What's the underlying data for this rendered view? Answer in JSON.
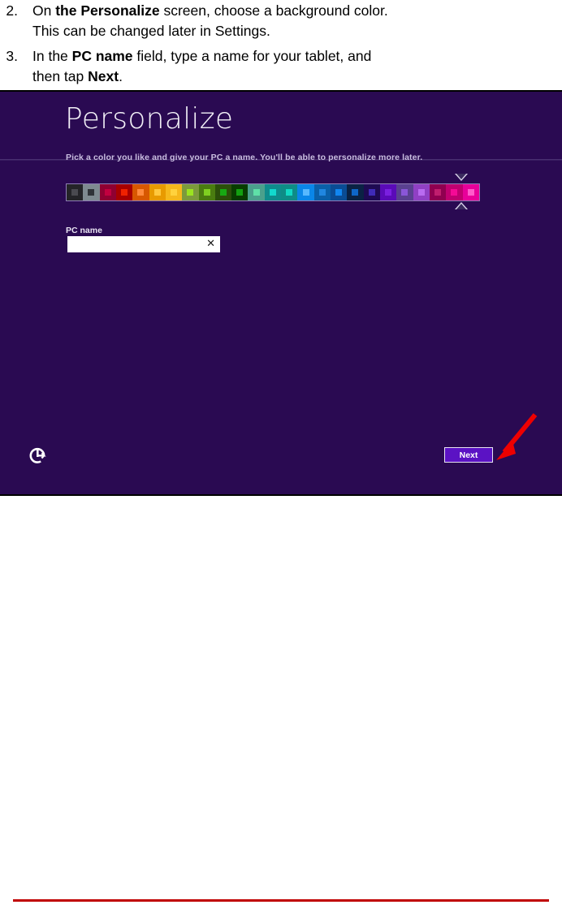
{
  "document": {
    "steps": [
      {
        "number": "2.",
        "line1_pre": "On ",
        "line1_bold": "the Personalize",
        "line1_post": " screen, choose a background color.",
        "line2": "This can be changed later in Settings."
      },
      {
        "number": "3.",
        "line1_pre": "In the ",
        "line1_bold": "PC name",
        "line1_post": " field, type a name for your tablet, and",
        "line2_pre": "then tap ",
        "line2_bold": "Next",
        "line2_post": "."
      }
    ]
  },
  "screenshot": {
    "title": "Personalize",
    "subtitle": "Pick a color you like and give your PC a name. You'll be able to personalize more later.",
    "background_color": "#2A0A52",
    "color_picker": {
      "name": "background-color-picker",
      "selected_index": 23,
      "swatches": [
        {
          "index": 0,
          "color": "#242428",
          "chip": "#4A4A50"
        },
        {
          "index": 1,
          "color": "#7E8A90",
          "chip": "#2F3338"
        },
        {
          "index": 2,
          "color": "#8F0032",
          "chip": "#C2003F"
        },
        {
          "index": 3,
          "color": "#A80000",
          "chip": "#F02200"
        },
        {
          "index": 4,
          "color": "#D85800",
          "chip": "#FF8A3D"
        },
        {
          "index": 5,
          "color": "#E89A00",
          "chip": "#FFC83D"
        },
        {
          "index": 6,
          "color": "#F5B81C",
          "chip": "#FFD23D"
        },
        {
          "index": 7,
          "color": "#7C9A3C",
          "chip": "#9BE320"
        },
        {
          "index": 8,
          "color": "#4A7C10",
          "chip": "#7FD021"
        },
        {
          "index": 9,
          "color": "#2B4F0A",
          "chip": "#17A913"
        },
        {
          "index": 10,
          "color": "#083D00",
          "chip": "#13A011"
        },
        {
          "index": 11,
          "color": "#4AA08C",
          "chip": "#5FE0A8"
        },
        {
          "index": 12,
          "color": "#0E8C8C",
          "chip": "#12D9CE"
        },
        {
          "index": 13,
          "color": "#0E8C86",
          "chip": "#12D9C4"
        },
        {
          "index": 14,
          "color": "#0A86E8",
          "chip": "#57B8FF"
        },
        {
          "index": 15,
          "color": "#0A5FA8",
          "chip": "#2086E0"
        },
        {
          "index": 16,
          "color": "#0A4C94",
          "chip": "#1186F0"
        },
        {
          "index": 17,
          "color": "#0A2244",
          "chip": "#0E66C8"
        },
        {
          "index": 18,
          "color": "#1E0A52",
          "chip": "#3F2BB8"
        },
        {
          "index": 19,
          "color": "#5A0AB8",
          "chip": "#7A1FE0"
        },
        {
          "index": 20,
          "color": "#5A4090",
          "chip": "#8A56D8"
        },
        {
          "index": 21,
          "color": "#9040C4",
          "chip": "#B96BF0"
        },
        {
          "index": 22,
          "color": "#8F0050",
          "chip": "#C01E6E"
        },
        {
          "index": 23,
          "color": "#C00070",
          "chip": "#F50A96"
        },
        {
          "index": 24,
          "color": "#E8009A",
          "chip": "#FF5CCB"
        }
      ]
    },
    "pc_name_field": {
      "label": "PC name",
      "value": "",
      "placeholder": "",
      "clear_glyph": "✕"
    },
    "ease_of_access": {
      "name": "ease-of-access-icon"
    },
    "next_button": {
      "label": "Next",
      "background": "#5B12C4",
      "border": "#E8E3F2"
    },
    "annotation": {
      "arrow_color": "#EE0000"
    }
  }
}
